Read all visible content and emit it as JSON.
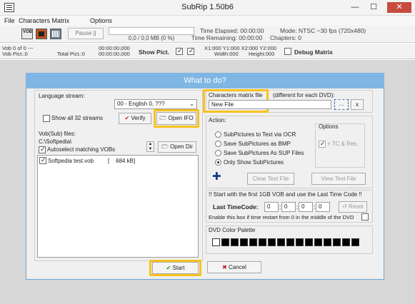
{
  "window": {
    "title": "SubRip 1.50b6",
    "min": "—",
    "max": "☐",
    "close": "✕"
  },
  "menu": [
    "File",
    "Characters Matrix",
    "Options"
  ],
  "toolbar": {
    "pause": "Pause ||",
    "progress_text": "0,0 / 0,0 MB (0 %)",
    "elapsed": "Time Elapsed: 00:00:00",
    "remaining": "Time Remaining: 00:00:00",
    "mode": "Mode: NTSC ~30 fps (720x480)",
    "chapters": "Chapters: 0"
  },
  "status": {
    "vob": "Vob 0    of 0    ---",
    "vob_pict": "Vob Pict.:0",
    "total_pict": "Total Pict.:0",
    "t1": "00:00:00,000",
    "t2": "00:00:00,000",
    "show_pict": "Show Pict.",
    "coords": "X1:000 Y1:000 X2:000 Y2:000",
    "width": "Width:000",
    "height": "Height:000",
    "debug": "Debug Matrix"
  },
  "dialog": {
    "title": "What to do?",
    "language_stream_label": "Language stream:",
    "language_stream_value": "00 - English 0, ???",
    "show_all_streams": "Show all 32 streams",
    "verify": "Verify",
    "open_ifo": "Open IFO",
    "vob_files_label": "Vob(Sub) files:",
    "vob_path": "C:\\Softpedia\\",
    "autoselect": "Autoselect matching VOBs",
    "open_dir": "Open Dir",
    "files": [
      {
        "name": "Softpedia test.vob",
        "size": "[    684 kB]"
      }
    ],
    "char_matrix_label": "Characters matrix file",
    "char_matrix_note": "(different for each DVD):",
    "char_matrix_value": "New File",
    "browse": "...",
    "clear_x": "x",
    "action_label": "Action:",
    "actions": [
      "SubPictures to Text via OCR",
      "Save SubPictures as BMP",
      "Save SubPictures As SUP Files",
      "Only Show SubPictures"
    ],
    "options_label": "Options",
    "tc_res": "+ TC & Res.",
    "clear_text_file": "Clear Text File",
    "view_text_file": "View Text File",
    "first_vob_note": "!! Start with the first 1GB VOB and use the Last Time Code !!",
    "last_timecode_label": "Last TimeCode:",
    "timecode": [
      "0",
      "0",
      "0",
      "0"
    ],
    "reset": "Reset",
    "restart_note": "Enable this box if time restart from 0 in the middle of the DVD",
    "palette_label": "DVD Color Palette",
    "start": "Start",
    "cancel": "Cancel"
  }
}
